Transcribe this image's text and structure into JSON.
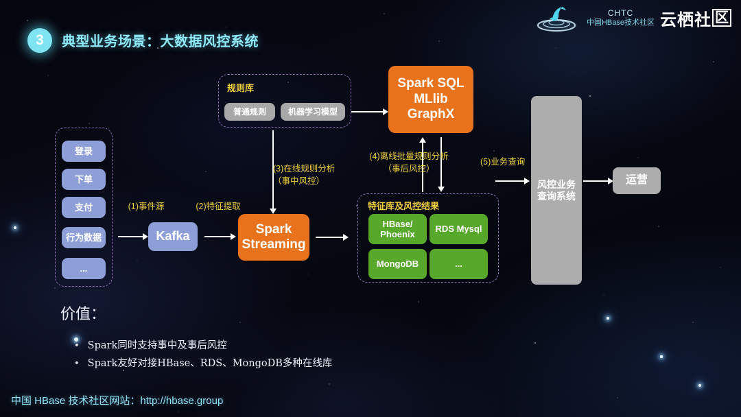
{
  "header": {
    "badge_number": "3",
    "title": "典型业务场景：大数据风控系统",
    "logo_dolphin_name": "dolphin-logo",
    "chtc_en": "CHTC",
    "chtc_cn": "中国HBase技术社区",
    "yunqi_main": "云栖社",
    "yunqi_boxed": "区"
  },
  "colors": {
    "accent_cyan": "#8fe9f7",
    "annotation_yellow": "#f2d23c",
    "dashed_purple": "#8f6fb8",
    "blue_box": "#8e9fd8",
    "orange_box": "#e8731c",
    "gray_box": "#a8a8a8",
    "green_box": "#57a82b",
    "background": "#05070f"
  },
  "diagram": {
    "event_sources": {
      "items": [
        "登录",
        "下单",
        "支付",
        "行为数据",
        "..."
      ]
    },
    "rules_library": {
      "label": "规则库",
      "items": [
        "普通规则",
        "机器学习模型"
      ]
    },
    "feature_store": {
      "label": "特征库及风控结果",
      "items": [
        "HBase/\nPhoenix",
        "RDS Mysql",
        "MongoDB",
        "..."
      ]
    },
    "nodes": {
      "kafka": "Kafka",
      "spark_streaming": "Spark\nStreaming",
      "spark_sql": "Spark SQL\nMLlib\nGraphX",
      "query_system": "风控业务\n查询系统",
      "operations": "运营"
    },
    "annotations": {
      "a1": "(1)事件源",
      "a2": "(2)特征提取",
      "a3": "(3)在线规则分析\n（事中风控）",
      "a4": "(4)离线批量规则分析\n（事后风控）",
      "a5": "(5)业务查询"
    }
  },
  "value_section": {
    "title": "价值：",
    "bullet_char": "•",
    "bullets": [
      "Spark同时支持事中及事后风控",
      "Spark友好对接HBase、RDS、MongoDB多种在线库"
    ]
  },
  "footer": {
    "text": "中国 HBase 技术社区网站：http://hbase.group"
  }
}
